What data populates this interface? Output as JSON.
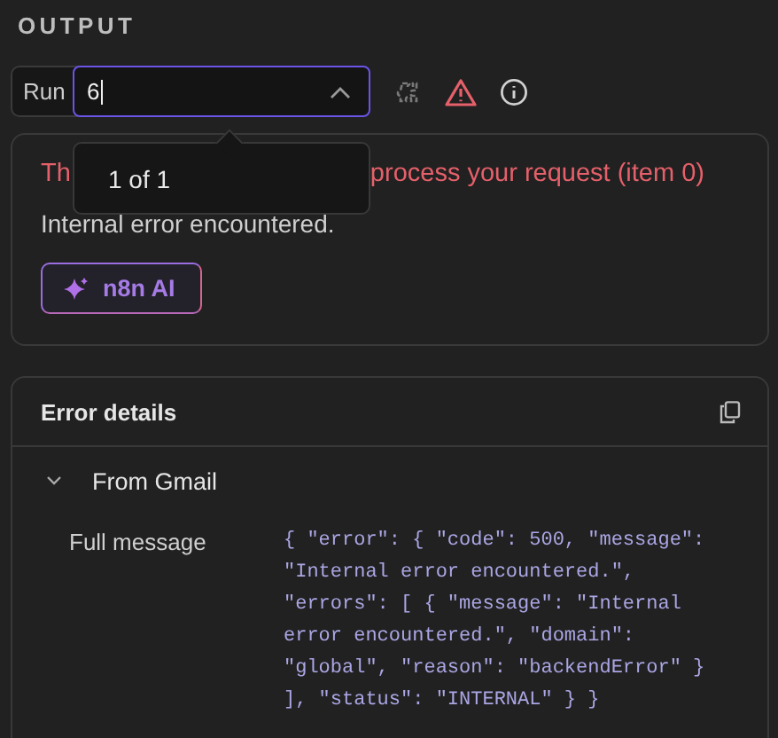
{
  "section_title": "OUTPUT",
  "run_selector": {
    "label": "Run",
    "value": "6",
    "expanded": true
  },
  "run_popup": {
    "text": "1 of 1"
  },
  "error": {
    "title_start": "Th",
    "title_end": "process your request (item 0)",
    "description": "Internal error encountered.",
    "ai_button": "n8n AI"
  },
  "error_details": {
    "title": "Error details",
    "groups": [
      {
        "name": "From Gmail",
        "expanded": true,
        "fields": [
          {
            "label": "Full message",
            "value": "{ \"error\": { \"code\": 500, \"message\": \"Internal error encountered.\", \"errors\": [ { \"message\": \"Internal error encountered.\", \"domain\": \"global\", \"reason\": \"backendError\" } ], \"status\": \"INTERNAL\" } }"
          }
        ]
      }
    ]
  }
}
